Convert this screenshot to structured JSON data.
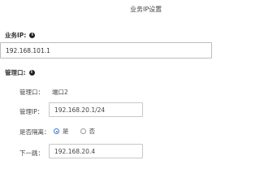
{
  "dialog": {
    "title": "业务IP设置"
  },
  "business_ip": {
    "label": "业务IP:",
    "value": "192.168.101.1"
  },
  "mgmt_port": {
    "label": "管理口:",
    "port_label": "管理口：",
    "port_value": "端口2",
    "ip_label": "管理IP：",
    "ip_value": "192.168.20.1/24",
    "isolate_label": "是否隔离：",
    "isolate_options": [
      "是",
      "否"
    ],
    "isolate_selected": "是",
    "gateway_label": "下一跳：",
    "gateway_value": "192.168.20.4"
  },
  "icons": {
    "info": "info-icon"
  }
}
